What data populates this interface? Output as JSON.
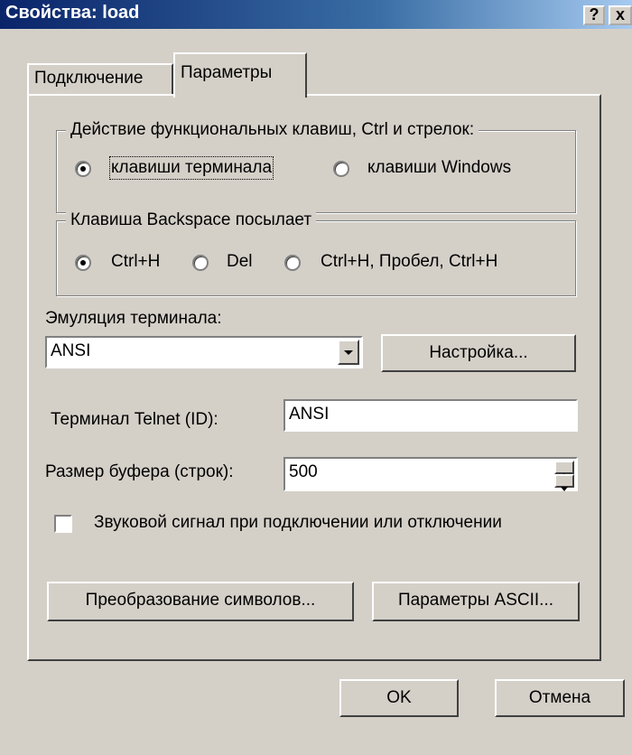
{
  "window": {
    "title": "Свойства: load",
    "help_button": "?",
    "close_button": "x"
  },
  "tabs": [
    {
      "label": "Подключение",
      "active": false
    },
    {
      "label": "Параметры",
      "active": true
    }
  ],
  "keys_group": {
    "legend": "Действие функциональных клавиш, Ctrl и стрелок:",
    "options": [
      {
        "label": "клавиши терминала",
        "selected": true
      },
      {
        "label": "клавиши Windows",
        "selected": false
      }
    ]
  },
  "backspace_group": {
    "legend": "Клавиша  Backspace посылает",
    "options": [
      {
        "label": "Ctrl+H",
        "selected": true
      },
      {
        "label": "Del",
        "selected": false
      },
      {
        "label": "Ctrl+H, Пробел, Ctrl+H",
        "selected": false
      }
    ]
  },
  "emulation": {
    "label": "Эмуляция терминала:",
    "value": "ANSI",
    "setup_button": "Настройка..."
  },
  "telnet_id": {
    "label": "Терминал Telnet (ID):",
    "value": "ANSI"
  },
  "buffer": {
    "label": "Размер буфера (строк):",
    "value": "500"
  },
  "sound": {
    "label": "Звуковой сигнал при подключении или отключении",
    "checked": false
  },
  "buttons": {
    "charset": "Преобразование символов...",
    "ascii": "Параметры ASCII...",
    "ok": "OK",
    "cancel": "Отмена"
  }
}
